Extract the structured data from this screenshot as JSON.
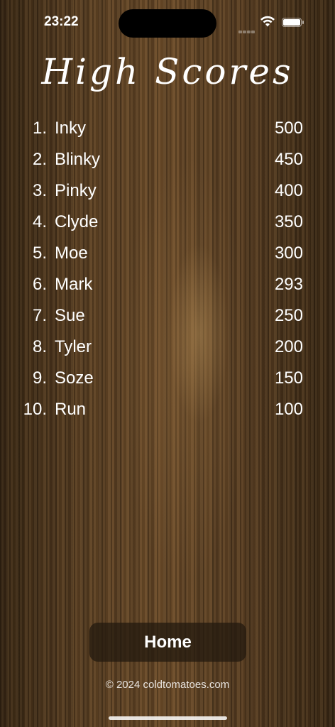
{
  "status_bar": {
    "time": "23:22"
  },
  "title": "High Scores",
  "scores": [
    {
      "rank": "1.",
      "name": "Inky",
      "score": "500"
    },
    {
      "rank": "2.",
      "name": "Blinky",
      "score": "450"
    },
    {
      "rank": "3.",
      "name": "Pinky",
      "score": "400"
    },
    {
      "rank": "4.",
      "name": "Clyde",
      "score": "350"
    },
    {
      "rank": "5.",
      "name": "Moe",
      "score": "300"
    },
    {
      "rank": "6.",
      "name": "Mark",
      "score": "293"
    },
    {
      "rank": "7.",
      "name": "Sue",
      "score": "250"
    },
    {
      "rank": "8.",
      "name": "Tyler",
      "score": "200"
    },
    {
      "rank": "9.",
      "name": "Soze",
      "score": "150"
    },
    {
      "rank": "10.",
      "name": "Run",
      "score": "100"
    }
  ],
  "home_button": {
    "label": "Home"
  },
  "footer": {
    "copyright": "© 2024 coldtomatoes.com"
  },
  "colors": {
    "text": "#ffffff",
    "button_bg": "#23190f",
    "wood": "#4a3520"
  },
  "icons": {
    "wifi": "wifi-icon",
    "battery": "battery-icon",
    "signal": "cellular-signal-icon"
  }
}
